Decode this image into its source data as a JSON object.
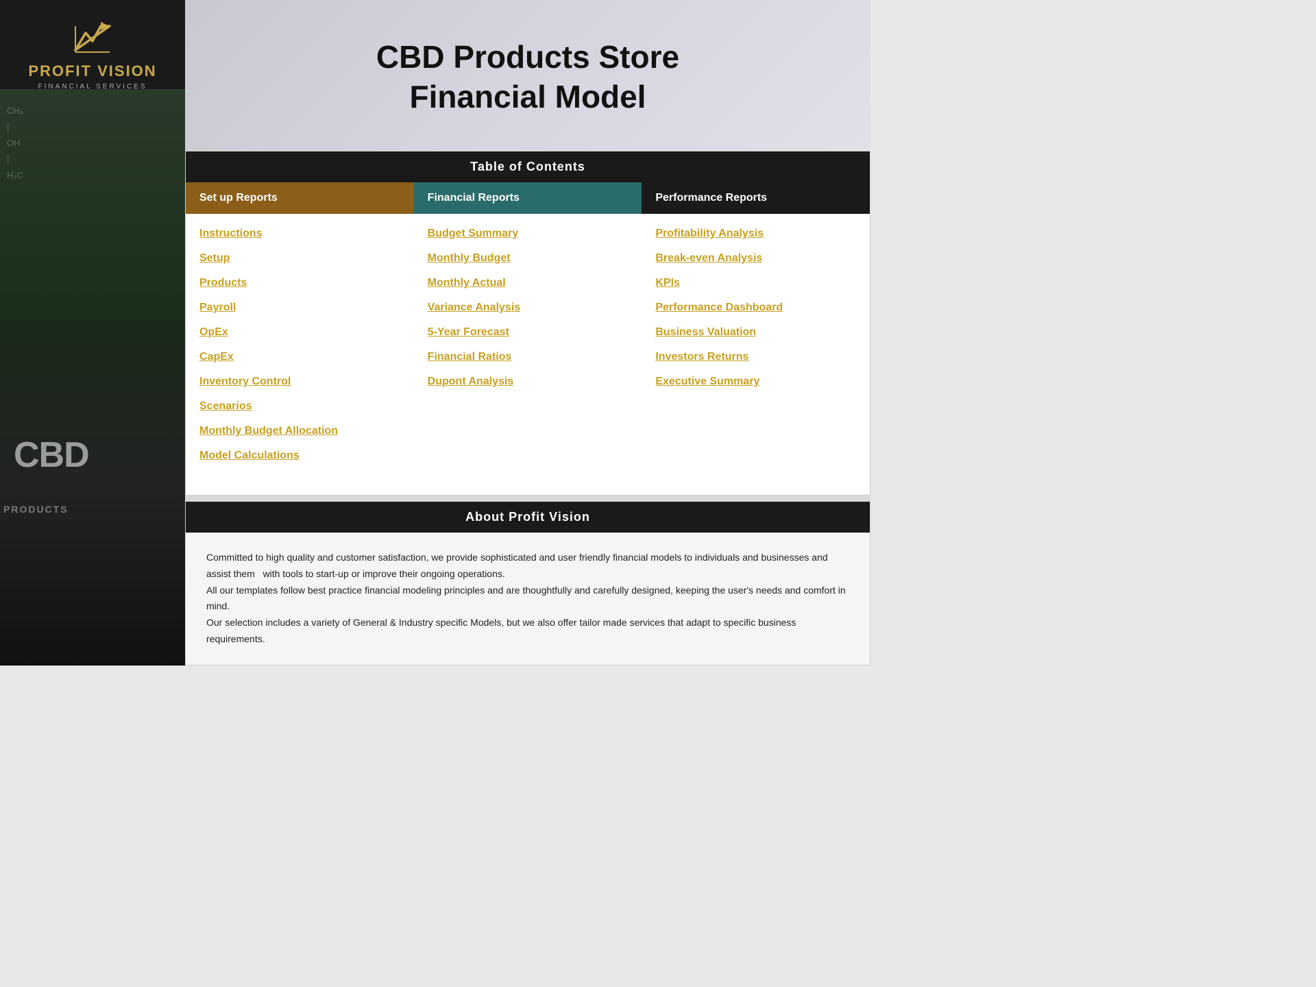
{
  "sidebar": {
    "logo_line1": "PROFIT",
    "logo_line2": "VISION",
    "logo_subtitle": "FINANCIAL SERVICES",
    "overlay_text": "CBD"
  },
  "header": {
    "title_line1": "CBD Products Store",
    "title_line2": "Financial Model"
  },
  "toc": {
    "section_title": "Table of Contents",
    "columns": [
      {
        "label": "Set up Reports",
        "type": "setup",
        "links": [
          "Instructions",
          "Setup",
          "Products",
          "Payroll",
          "OpEx",
          "CapEx",
          "Inventory Control",
          "Scenarios",
          "Monthly Budget Allocation",
          "Model Calculations"
        ]
      },
      {
        "label": "Financial Reports",
        "type": "financial",
        "links": [
          "Budget Summary",
          "Monthly Budget",
          "Monthly Actual",
          "Variance Analysis",
          "5-Year Forecast",
          "Financial Ratios",
          "Dupont Analysis"
        ]
      },
      {
        "label": "Performance Reports",
        "type": "performance",
        "links": [
          "Profitability Analysis",
          "Break-even Analysis",
          "KPIs",
          "Performance Dashboard",
          "Business Valuation",
          "Investors Returns",
          "Executive Summary"
        ]
      }
    ]
  },
  "about": {
    "section_title": "About Profit Vision",
    "body_text": "Committed to high quality and customer satisfaction, we provide sophisticated and user friendly financial models to individuals and businesses and assist them  with tools to start-up or improve their ongoing operations.\nAll our templates follow best practice financial modeling principles and are thoughtfully and carefully designed, keeping the user's needs and comfort in mind.\nOur selection includes a variety of General & Industry specific Models, but we also offer tailor made services that adapt to specific business requirements."
  }
}
